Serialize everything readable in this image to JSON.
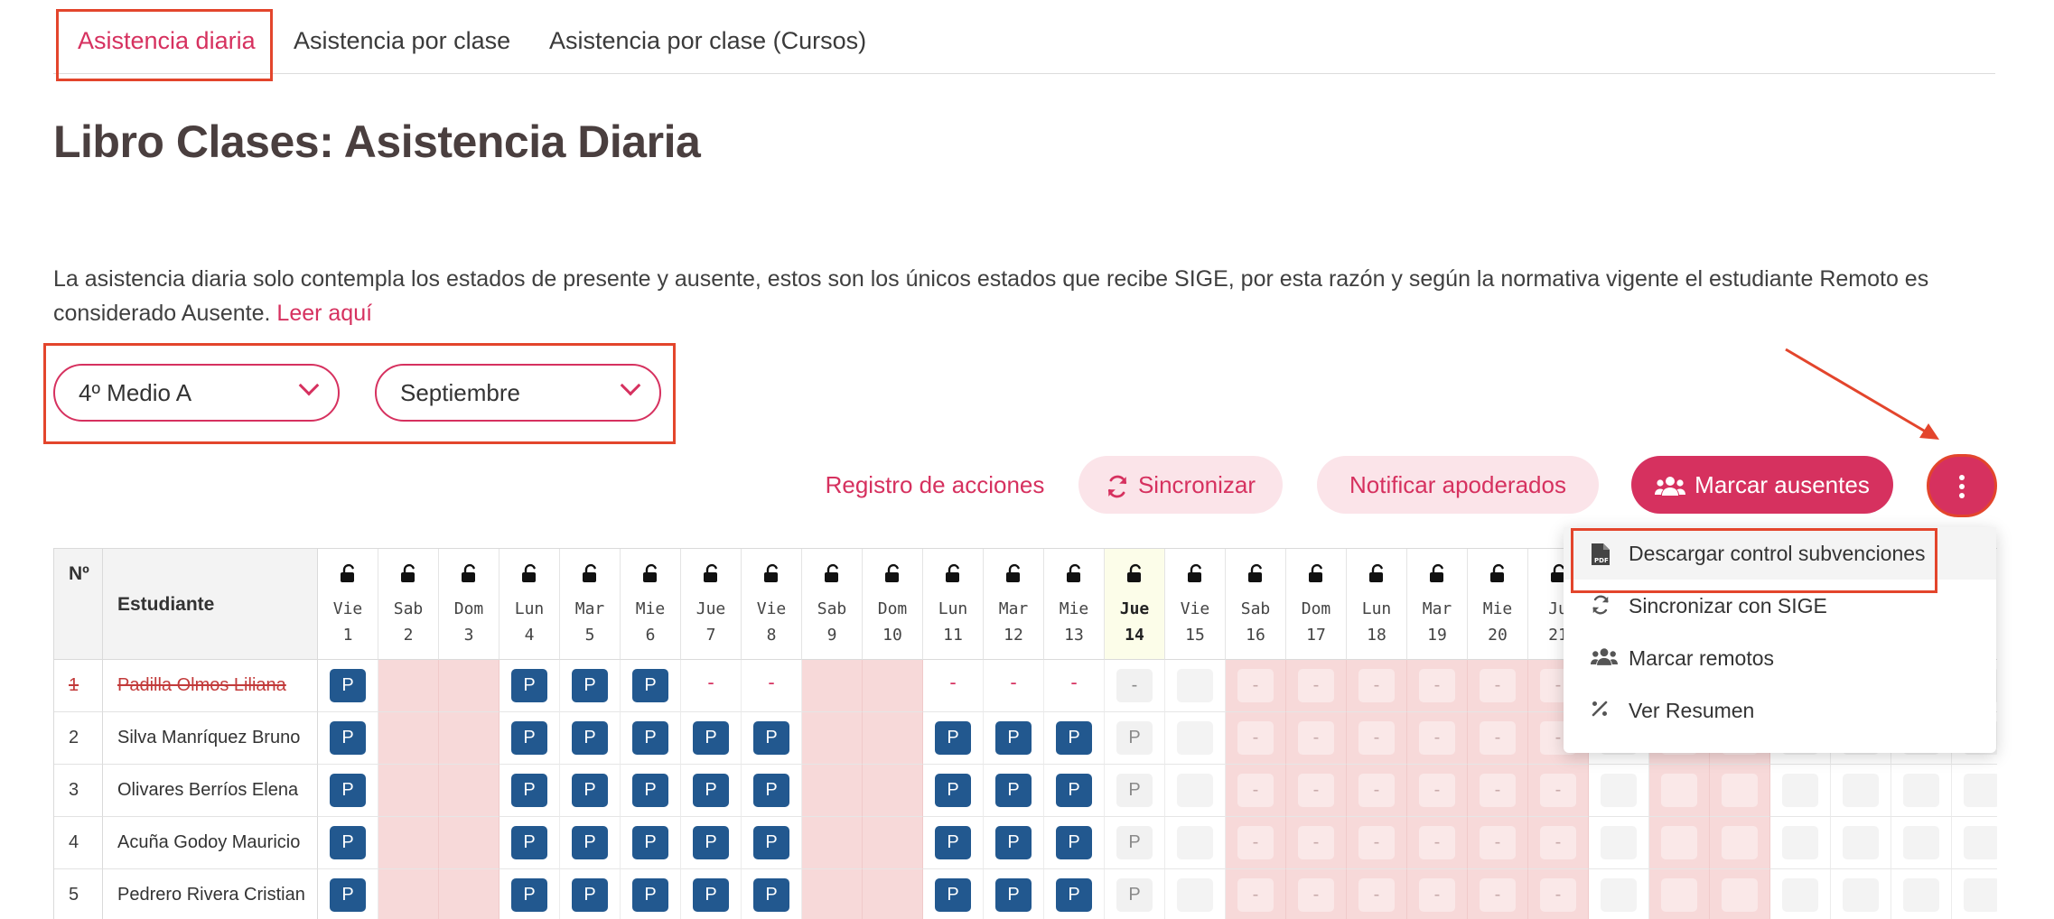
{
  "tabs": [
    {
      "label": "Asistencia diaria",
      "active": true
    },
    {
      "label": "Asistencia por clase",
      "active": false
    },
    {
      "label": "Asistencia por clase (Cursos)",
      "active": false
    }
  ],
  "page_title": "Libro Clases: Asistencia Diaria",
  "description": {
    "text": "La asistencia diaria solo contempla los estados de presente y ausente, estos son los únicos estados que recibe SIGE, por esta razón y según la normativa vigente el estudiante Remoto es considerado Ausente.",
    "link": "Leer aquí"
  },
  "filters": {
    "course": "4º Medio A",
    "month": "Septiembre"
  },
  "actions": {
    "log": "Registro de acciones",
    "sync": "Sincronizar",
    "notify": "Notificar apoderados",
    "mark_absent": "Marcar ausentes"
  },
  "menu": [
    {
      "label": "Descargar control subvenciones",
      "icon": "pdf-file-icon"
    },
    {
      "label": "Sincronizar con SIGE",
      "icon": "sync-icon"
    },
    {
      "label": "Marcar remotos",
      "icon": "users-icon"
    },
    {
      "label": "Ver Resumen",
      "icon": "percent-icon"
    }
  ],
  "table": {
    "col_no": "Nº",
    "col_student": "Estudiante",
    "days": [
      {
        "name": "Vie",
        "num": "1"
      },
      {
        "name": "Sab",
        "num": "2"
      },
      {
        "name": "Dom",
        "num": "3"
      },
      {
        "name": "Lun",
        "num": "4"
      },
      {
        "name": "Mar",
        "num": "5"
      },
      {
        "name": "Mie",
        "num": "6"
      },
      {
        "name": "Jue",
        "num": "7"
      },
      {
        "name": "Vie",
        "num": "8"
      },
      {
        "name": "Sab",
        "num": "9"
      },
      {
        "name": "Dom",
        "num": "10"
      },
      {
        "name": "Lun",
        "num": "11"
      },
      {
        "name": "Mar",
        "num": "12"
      },
      {
        "name": "Mie",
        "num": "13"
      },
      {
        "name": "Jue",
        "num": "14"
      },
      {
        "name": "Vie",
        "num": "15"
      },
      {
        "name": "Sab",
        "num": "16"
      },
      {
        "name": "Dom",
        "num": "17"
      },
      {
        "name": "Lun",
        "num": "18"
      },
      {
        "name": "Mar",
        "num": "19"
      },
      {
        "name": "Mie",
        "num": "20"
      },
      {
        "name": "Ju",
        "num": "21"
      },
      {
        "name": "",
        "num": ""
      },
      {
        "name": "",
        "num": ""
      },
      {
        "name": "",
        "num": ""
      },
      {
        "name": "",
        "num": ""
      },
      {
        "name": "",
        "num": ""
      },
      {
        "name": "",
        "num": ""
      },
      {
        "name": "",
        "num": ""
      },
      {
        "name": "",
        "num": ""
      },
      {
        "name": "",
        "num": ""
      }
    ],
    "today_index": 13,
    "weekend_indices": [
      1,
      2,
      8,
      9,
      15,
      16,
      22,
      23
    ],
    "rows": [
      {
        "no": "1",
        "name": "Padilla Olmos Liliana",
        "withdrawn": true,
        "cells": [
          "P",
          "",
          "",
          "P",
          "P",
          "P",
          "-",
          "-",
          "",
          "",
          "-",
          "-",
          "-",
          "-f",
          "",
          "",
          "",
          "",
          "",
          "",
          "",
          "",
          "",
          "",
          "",
          "",
          "",
          "",
          "",
          ""
        ]
      },
      {
        "no": "2",
        "name": "Silva Manríquez Bruno",
        "withdrawn": false,
        "cells": [
          "P",
          "",
          "",
          "P",
          "P",
          "P",
          "P",
          "P",
          "",
          "",
          "P",
          "P",
          "P",
          "Pf",
          "",
          "",
          "",
          "",
          "",
          "",
          "",
          "",
          "",
          "",
          "",
          "",
          "",
          "",
          "",
          ""
        ]
      },
      {
        "no": "3",
        "name": "Olivares Berríos Elena",
        "withdrawn": false,
        "cells": [
          "P",
          "",
          "",
          "P",
          "P",
          "P",
          "P",
          "P",
          "",
          "",
          "P",
          "P",
          "P",
          "Pf",
          "",
          "",
          "",
          "",
          "",
          "",
          "",
          "",
          "",
          "",
          "",
          "",
          "",
          "",
          "",
          ""
        ]
      },
      {
        "no": "4",
        "name": "Acuña Godoy Mauricio",
        "withdrawn": false,
        "cells": [
          "P",
          "",
          "",
          "P",
          "P",
          "P",
          "P",
          "P",
          "",
          "",
          "P",
          "P",
          "P",
          "Pf",
          "",
          "",
          "",
          "",
          "",
          "",
          "",
          "",
          "",
          "",
          "",
          "",
          "",
          "",
          "",
          ""
        ]
      },
      {
        "no": "5",
        "name": "Pedrero Rivera Cristian",
        "withdrawn": false,
        "cells": [
          "P",
          "",
          "",
          "P",
          "P",
          "P",
          "P",
          "P",
          "",
          "",
          "P",
          "P",
          "P",
          "Pf",
          "",
          "",
          "",
          "",
          "",
          "",
          "",
          "",
          "",
          "",
          "",
          "",
          "",
          "",
          "",
          ""
        ]
      }
    ]
  },
  "colors": {
    "accent": "#d6315f",
    "accent_soft": "#fbe4e9",
    "present": "#22588f",
    "weekend": "#f7d9d9",
    "annotation": "#e3452c"
  }
}
